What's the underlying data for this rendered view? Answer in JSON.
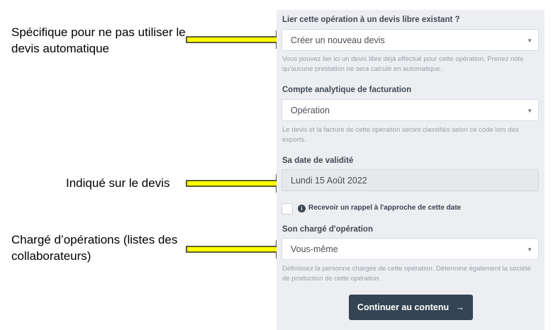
{
  "annotations": {
    "note1": "Spécifique pour ne pas utiliser le devis automatique",
    "note2": "Indiqué sur le devis",
    "note3": "Chargé d’opérations (listes des collaborateurs)"
  },
  "form": {
    "devis": {
      "label": "Lier cette opération à un devis libre existant ?",
      "value": "Créer un nouveau devis",
      "help": "Vous pouvez lier ici un devis libre déjà effectué pour cette opération. Prenez note qu'aucune prestation ne sera calculé en automatique."
    },
    "compte": {
      "label": "Compte analytique de facturation",
      "value": "Opération",
      "help": "Le devis et la facture de cette opération seront classifiés selon ce code lors des exports."
    },
    "validite": {
      "label": "Sa date de validité",
      "value": "Lundi 15 Août 2022"
    },
    "rappel": {
      "label": "Recevoir un rappel à l'approche de cette date",
      "checked": false
    },
    "charge": {
      "label": "Son chargé d'opération",
      "value": "Vous-même",
      "help": "Définissez la personne chargée de cette opération. Détermine également la société de production de cette opération."
    },
    "continue_label": "Continuer au contenu",
    "continue_arrow": "→"
  },
  "icons": {
    "caret": "▼",
    "info": "i"
  },
  "colors": {
    "panel_bg": "#eceef1",
    "button_bg": "#344454",
    "arrow_fill": "#ffff00"
  }
}
